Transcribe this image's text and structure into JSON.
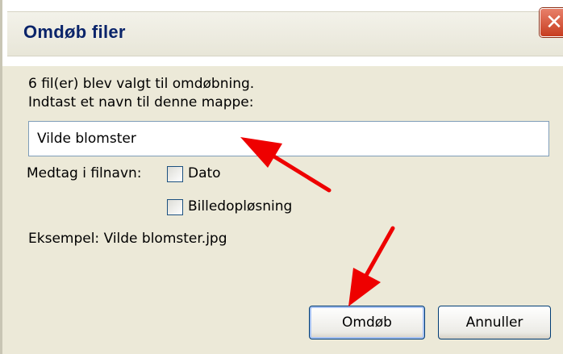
{
  "dialog": {
    "title": "Omdøb filer",
    "close_glyph": "✕",
    "info_line1": "6 fil(er) blev valgt til omdøbning.",
    "info_line2": "Indtast et navn til denne mappe:",
    "name_value": "Vilde blomster",
    "include_label": "Medtag i filnavn:",
    "options": [
      {
        "label": "Dato",
        "checked": false
      },
      {
        "label": "Billedopløsning",
        "checked": false
      }
    ],
    "example_text": "Eksempel: Vilde blomster.jpg",
    "rename_button": "Omdøb",
    "cancel_button": "Annuller"
  },
  "annotations": {
    "arrow_color": "#ee0000"
  }
}
